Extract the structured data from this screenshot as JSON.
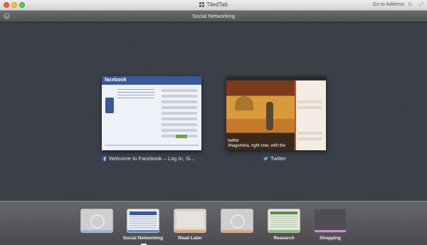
{
  "window": {
    "title": "TiledTab",
    "go_to_address": "Go to Address",
    "reload_icon": "reload-icon",
    "expand_icon": "expand-icon"
  },
  "group_header": {
    "title": "Social Networking",
    "close_icon": "close-icon"
  },
  "tabs": [
    {
      "label": "Welcome to Facebook – Log In, Si...",
      "favicon": "facebook-icon",
      "thumb_text": "facebook"
    },
    {
      "label": "Twitter",
      "favicon": "twitter-bird-icon",
      "thumb_caption": "twitter\n#hagomina, right now, with the"
    }
  ],
  "groups": [
    {
      "label": "",
      "strip_color": "#8fb7e0"
    },
    {
      "label": "Social Networking",
      "strip_color": "#5a8fd0"
    },
    {
      "label": "Read Later",
      "strip_color": "#e7a363"
    },
    {
      "label": "",
      "strip_color": "#e7a363"
    },
    {
      "label": "Research",
      "strip_color": "#7ec07a"
    },
    {
      "label": "Shopping",
      "strip_color": "#d48bd0"
    }
  ],
  "colors": {
    "facebook_blue": "#3b5998",
    "twitter_blue": "#55acee"
  }
}
